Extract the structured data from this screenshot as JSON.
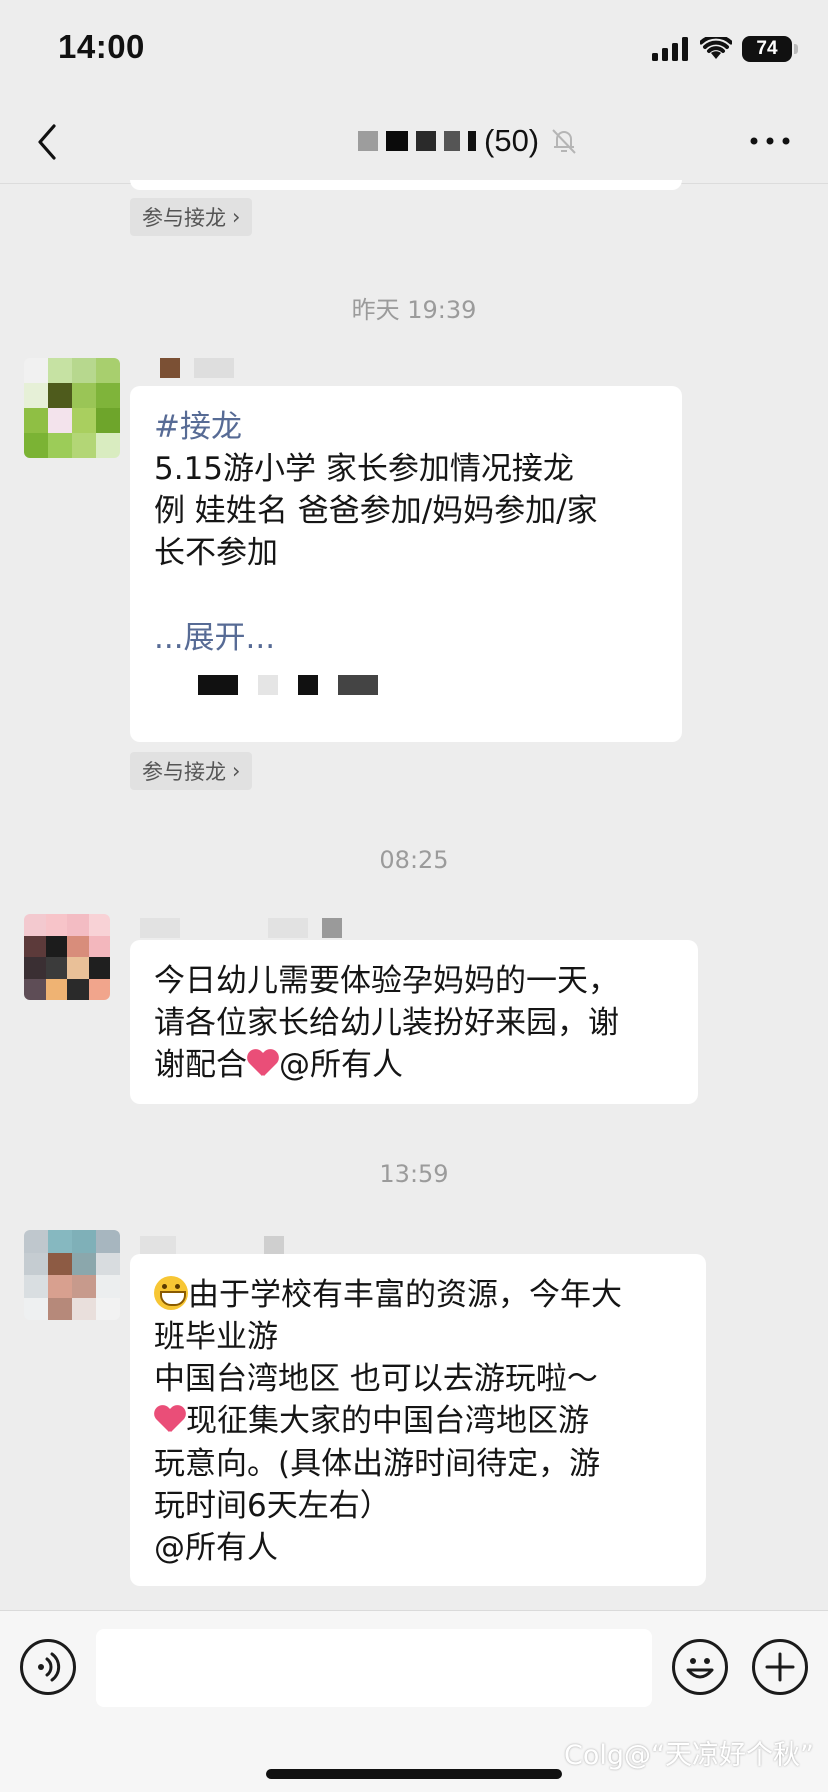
{
  "status_bar": {
    "time": "14:00",
    "battery": "74"
  },
  "header": {
    "group_count": "(50)",
    "back_icon": "chevron-left-icon",
    "mute_icon": "bell-muted-icon",
    "more_icon": "ellipsis-icon"
  },
  "chat": {
    "join_label": "参与接龙",
    "join_chevron": "›",
    "messages": [
      {
        "timestamp": "昨天 19:39",
        "tag": "#接龙",
        "lines": [
          "5.15游小学 家长参加情况接龙",
          "例 娃姓名 爸爸参加/妈妈参加/家",
          "长不参加"
        ],
        "expand": "...展开..."
      },
      {
        "timestamp": "08:25",
        "lines": [
          "今日幼儿需要体验孕妈妈的一天，",
          "请各位家长给幼儿装扮好来园，谢"
        ],
        "last_line": "配合",
        "last_line_prefix": "谢",
        "mention": "@所有人"
      },
      {
        "timestamp": "13:59",
        "line1": "由于学校有丰富的资源，今年大",
        "line2": "班毕业游",
        "line3": "中国台湾地区 也可以去游玩啦～",
        "line4": "现征集大家的中国台湾地区游",
        "line5": "玩意向。(具体出游时间待定，游",
        "line6": "玩时间6天左右）",
        "mention": "@所有人"
      }
    ]
  },
  "input_bar": {
    "voice_icon": "voice-icon",
    "emoji_icon": "emoji-icon",
    "plus_icon": "plus-icon"
  },
  "watermark": "Colg@“天凉好个秋”",
  "colors": {
    "background": "#ededed",
    "bubble": "#ffffff",
    "link": "#576b95",
    "heart": "#ea4e78"
  }
}
